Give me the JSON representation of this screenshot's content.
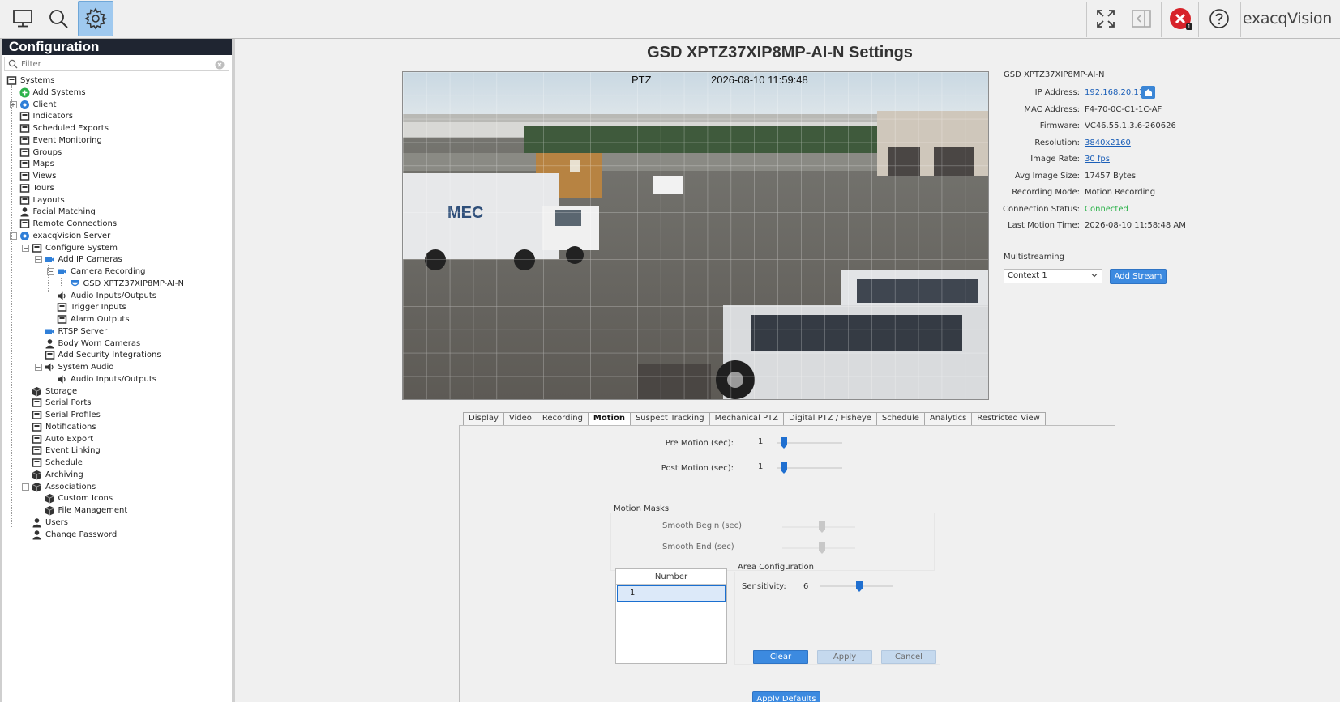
{
  "toolbar": {
    "brand": "exacqVision",
    "alert_badge": "1",
    "buttons": [
      "monitor-icon",
      "search-icon",
      "gear-icon",
      "fullscreen-icon",
      "collapse-panel-icon",
      "error-alert-icon",
      "help-icon"
    ]
  },
  "sidebar": {
    "title": "Configuration",
    "filter_placeholder": "Filter",
    "items": [
      {
        "label": "Systems",
        "icon": "systems-icon"
      },
      {
        "label": "Add Systems",
        "icon": "add-icon"
      },
      {
        "label": "Client",
        "icon": "client-icon"
      },
      {
        "label": "Indicators",
        "icon": "flag-icon"
      },
      {
        "label": "Scheduled Exports",
        "icon": "export-icon"
      },
      {
        "label": "Event Monitoring",
        "icon": "event-monitor-icon"
      },
      {
        "label": "Groups",
        "icon": "groups-icon"
      },
      {
        "label": "Maps",
        "icon": "map-icon"
      },
      {
        "label": "Views",
        "icon": "view-icon"
      },
      {
        "label": "Tours",
        "icon": "tours-icon"
      },
      {
        "label": "Layouts",
        "icon": "layout-icon"
      },
      {
        "label": "Facial Matching",
        "icon": "face-icon"
      },
      {
        "label": "Remote Connections",
        "icon": "remote-icon"
      },
      {
        "label": "exacqVision Server",
        "icon": "server-gear-icon"
      },
      {
        "label": "Configure System",
        "icon": "configure-icon"
      },
      {
        "label": "Add IP Cameras",
        "icon": "camera-icon"
      },
      {
        "label": "Camera Recording",
        "icon": "camera-icon"
      },
      {
        "label": "GSD XPTZ37XIP8MP-AI-N",
        "icon": "dome-camera-icon"
      },
      {
        "label": "Audio Inputs/Outputs",
        "icon": "speaker-icon"
      },
      {
        "label": "Trigger Inputs",
        "icon": "trigger-icon"
      },
      {
        "label": "Alarm Outputs",
        "icon": "alarm-icon"
      },
      {
        "label": "RTSP Server",
        "icon": "rtsp-icon"
      },
      {
        "label": "Body Worn Cameras",
        "icon": "person-icon"
      },
      {
        "label": "Add Security Integrations",
        "icon": "shield-icon"
      },
      {
        "label": "System Audio",
        "icon": "speaker-icon"
      },
      {
        "label": "Audio Inputs/Outputs",
        "icon": "speaker-icon"
      },
      {
        "label": "Storage",
        "icon": "storage-icon"
      },
      {
        "label": "Serial Ports",
        "icon": "serial-icon"
      },
      {
        "label": "Serial Profiles",
        "icon": "serial-profile-icon"
      },
      {
        "label": "Notifications",
        "icon": "notification-icon"
      },
      {
        "label": "Auto Export",
        "icon": "download-icon"
      },
      {
        "label": "Event Linking",
        "icon": "event-link-icon"
      },
      {
        "label": "Schedule",
        "icon": "calendar-icon"
      },
      {
        "label": "Archiving",
        "icon": "archive-icon"
      },
      {
        "label": "Associations",
        "icon": "box-icon"
      },
      {
        "label": "Custom Icons",
        "icon": "box-icon"
      },
      {
        "label": "File Management",
        "icon": "box-icon"
      },
      {
        "label": "Users",
        "icon": "user-icon"
      },
      {
        "label": "Change Password",
        "icon": "user-icon"
      }
    ]
  },
  "page": {
    "title": "GSD XPTZ37XIP8MP-AI-N Settings"
  },
  "video": {
    "osd_mode": "PTZ",
    "osd_timestamp": "2026-08-10 11:59:48"
  },
  "info": {
    "camera_name": "GSD XPTZ37XIP8MP-AI-N",
    "rows": [
      {
        "label": "IP Address:",
        "value": "192.168.20.115",
        "kind": "link"
      },
      {
        "label": "MAC Address:",
        "value": "F4-70-0C-C1-1C-AF",
        "kind": "text"
      },
      {
        "label": "Firmware:",
        "value": "VC46.55.1.3.6-260626",
        "kind": "text"
      },
      {
        "label": "Resolution:",
        "value": "3840x2160",
        "kind": "link"
      },
      {
        "label": "Image Rate:",
        "value": "30 fps",
        "kind": "link"
      },
      {
        "label": "Avg Image Size:",
        "value": "17457 Bytes",
        "kind": "text"
      },
      {
        "label": "Recording Mode:",
        "value": "Motion Recording",
        "kind": "text"
      },
      {
        "label": "Connection Status:",
        "value": "Connected",
        "kind": "ok"
      },
      {
        "label": "Last Motion Time:",
        "value": "2026-08-10 11:58:48 AM",
        "kind": "text"
      }
    ],
    "multistreaming_label": "Multistreaming",
    "context_value": "Context 1",
    "add_stream_label": "Add Stream"
  },
  "tabs": [
    {
      "label": "Display",
      "active": false
    },
    {
      "label": "Video",
      "active": false
    },
    {
      "label": "Recording",
      "active": false
    },
    {
      "label": "Motion",
      "active": true
    },
    {
      "label": "Suspect Tracking",
      "active": false
    },
    {
      "label": "Mechanical PTZ",
      "active": false
    },
    {
      "label": "Digital PTZ / Fisheye",
      "active": false
    },
    {
      "label": "Schedule",
      "active": false
    },
    {
      "label": "Analytics",
      "active": false
    },
    {
      "label": "Restricted View",
      "active": false
    }
  ],
  "motion": {
    "pre_motion_label": "Pre Motion (sec):",
    "pre_motion_value": "1",
    "pre_motion_level": 0.05,
    "post_motion_label": "Post Motion (sec):",
    "post_motion_value": "1",
    "post_motion_level": 0.05,
    "masks_label": "Motion Masks",
    "smooth_begin_label": "Smooth Begin (sec)",
    "smooth_end_label": "Smooth End (sec)",
    "number_header": "Number",
    "number_rows": [
      "1"
    ],
    "area_label": "Area Configuration",
    "sensitivity_label": "Sensitivity:",
    "sensitivity_value": "6",
    "sensitivity_level": 0.55,
    "clear_label": "Clear",
    "apply_label": "Apply",
    "cancel_label": "Cancel",
    "apply_defaults_label": "Apply Defaults"
  },
  "colors": {
    "accent": "#3c8ae0",
    "header_dark": "#1f2531",
    "connected": "#2db24b",
    "link": "#1b5fb8"
  }
}
